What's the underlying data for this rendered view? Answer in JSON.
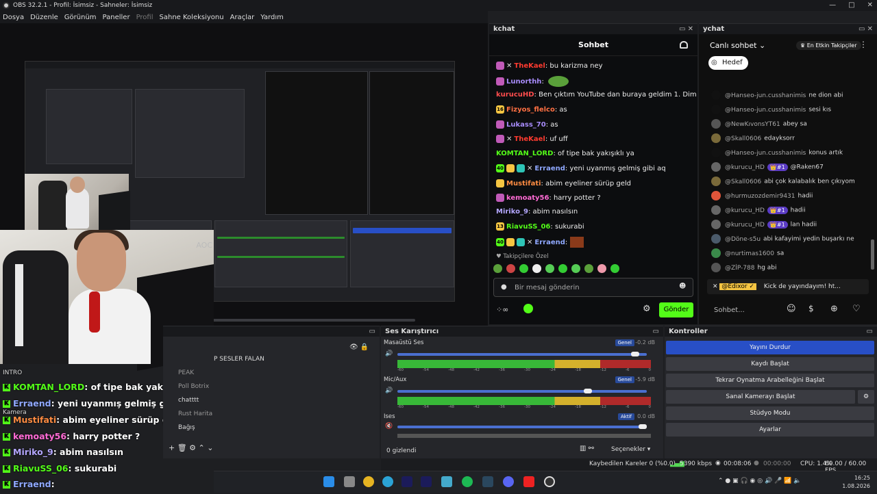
{
  "window": {
    "title": "OBS 32.2.1 - Profil: İsimsiz - Sahneler: İsimsiz",
    "min": "—",
    "max": "□",
    "close": "✕"
  },
  "menu": [
    "Dosya",
    "Düzenle",
    "Görünüm",
    "Paneller",
    "Profil",
    "Sahne Koleksiyonu",
    "Araçlar",
    "Yardım"
  ],
  "kchat": {
    "dock_title": "kchat",
    "header": "Sohbet",
    "input_placeholder": "Bir mesaj gönderin",
    "send": "Gönder",
    "followers_label": "Takipçilere Özel",
    "messages": [
      {
        "user": "TheKael",
        "text": ": bu karizma ney",
        "color": "#ff3b30"
      },
      {
        "user": "Lunorthh",
        "text": ":",
        "color": "#a78bfa"
      },
      {
        "user": "kurucuHD",
        "text": ": Ben çıktım YouTube dan buraya geldim 1. Dim",
        "color": "#ff4d4d"
      },
      {
        "user": "Fizyos_flelco",
        "text": ": as",
        "color": "#ff7043"
      },
      {
        "user": "Lukass_70",
        "text": ": as",
        "color": "#a78bfa"
      },
      {
        "user": "TheKael",
        "text": ": uf uff",
        "color": "#ff3b30"
      },
      {
        "user": "KOMTAN_LORD",
        "text": ": of tipe bak yakışıklı ya",
        "color": "#53fc18"
      },
      {
        "user": "Erraend",
        "text": ": yeni uyanmış gelmiş gibi aq",
        "color": "#8fa8ff"
      },
      {
        "user": "Mustifati",
        "text": ": abim eyeliner sürüp geld",
        "color": "#ff8c42"
      },
      {
        "user": "kemoaty56",
        "text": ": harry potter ?",
        "color": "#ff6bd5"
      },
      {
        "user": "Miriko_9",
        "text": ": abim nasılsın",
        "color": "#b4a7ff"
      },
      {
        "user": "RiavuSS_06",
        "text": ": sukurabi",
        "color": "#53fc18"
      },
      {
        "user": "Erraend",
        "text": ":",
        "color": "#8fa8ff"
      }
    ]
  },
  "ychat": {
    "dock_title": "ychat",
    "mode": "Canlı sohbet",
    "top_fans": "En Etkin Takipçiler",
    "hedef": "Hedef",
    "search": "Sohbet...",
    "pinned": {
      "user": "@Edixor ✓",
      "text": "Kick de yayındayım! ht..."
    },
    "messages": [
      {
        "name": "@Hanseo-jun.cusshanimis",
        "text": "ne dion abi",
        "badge": ""
      },
      {
        "name": "@Hanseo-jun.cusshanimis",
        "text": "sesi kıs",
        "badge": ""
      },
      {
        "name": "@NewKıvonsYT61",
        "text": "abey sa",
        "badge": ""
      },
      {
        "name": "@Skall0606",
        "text": "edayksorr",
        "badge": ""
      },
      {
        "name": "@Hanseo-jun.cusshanimis",
        "text": "konus artık",
        "badge": ""
      },
      {
        "name": "@kurucu_HD",
        "text": "@Raken67",
        "badge": "👑#1"
      },
      {
        "name": "@Skall0606",
        "text": "abi çok kalabalık ben çıkıyom",
        "badge": ""
      },
      {
        "name": "@hurmuzozdemir9431",
        "text": "hadii",
        "badge": ""
      },
      {
        "name": "@kurucu_HD",
        "text": "hadii",
        "badge": "👑#1"
      },
      {
        "name": "@kurucu_HD",
        "text": "lan hadii",
        "badge": "👑#1"
      },
      {
        "name": "@Döne-s5u",
        "text": "abi kafayimi yedin buşarkı ne",
        "badge": ""
      },
      {
        "name": "@nurtimas1600",
        "text": "sa",
        "badge": ""
      },
      {
        "name": "@ZİP-788",
        "text": "hg abi",
        "badge": ""
      }
    ]
  },
  "overlay": {
    "scene": "INTRO",
    "camera": "Kamera",
    "rows": [
      {
        "user": "KOMTAN_LORD",
        "text": ": of tipe bak yakışıklı ya",
        "color": "#53fc18"
      },
      {
        "user": "Erraend",
        "text": ": yeni uyanmış gelmiş gibi aq",
        "color": "#8fa8ff"
      },
      {
        "user": "Mustifati",
        "text": ": abim eyeliner sürüp geld",
        "color": "#ff8c42"
      },
      {
        "user": "kemoaty56",
        "text": ": harry potter ?",
        "color": "#ff6bd5"
      },
      {
        "user": "Miriko_9",
        "text": ": abim nasılsın",
        "color": "#b4a7ff"
      },
      {
        "user": "RiavuSS_06",
        "text": ": sukurabi",
        "color": "#53fc18"
      },
      {
        "user": "Erraend",
        "text": ":",
        "color": "#8fa8ff"
      }
    ]
  },
  "sources": {
    "items": [
      "P SESLER FALAN",
      "PEAK",
      "Poll Botrix",
      "chatttt",
      "Rust Harita",
      "Bağış"
    ],
    "hidden_count": "0 gizlendi"
  },
  "mixer": {
    "title": "Ses Karıştırıcı",
    "options": "Seçenekler",
    "channels": [
      {
        "name": "Masaüstü Ses",
        "db": "-0.2 dB",
        "mode": "Genel",
        "level": 0.97
      },
      {
        "name": "Mic/Aux",
        "db": "-5.9 dB",
        "mode": "Genel",
        "level": 0.78
      },
      {
        "name": "Ises",
        "db": "0.0 dB",
        "mode": "Aktif",
        "level": 1.0
      }
    ],
    "scale": [
      "-60",
      "-54",
      "-48",
      "-42",
      "-36",
      "-30",
      "-24",
      "-18",
      "-12",
      "-6",
      "0"
    ]
  },
  "controls": {
    "title": "Kontroller",
    "buttons": [
      "Yayını Durdur",
      "Kaydı Başlat",
      "Tekrar Oynatma Arabelleğini Başlat",
      "Sanal Kamerayı Başlat",
      "Stüdyo Modu",
      "Ayarlar"
    ]
  },
  "status": {
    "dropped": "Kaybedilen Kareler 0 (%0.0)",
    "bitrate": "5390 kbps",
    "stream_time": "00:08:06",
    "rec_time": "00:00:00",
    "cpu": "CPU: 1.4%",
    "fps": "60.00 / 60.00 FPS"
  },
  "clock": {
    "time": "16:25",
    "date": "1.08.2026"
  }
}
